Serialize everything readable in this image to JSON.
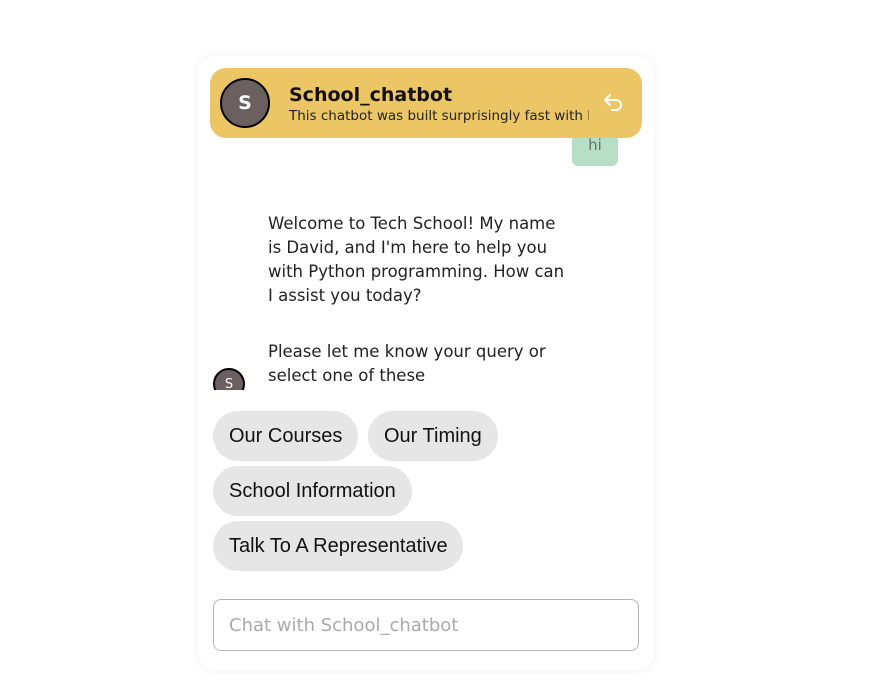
{
  "header": {
    "avatar_letter": "S",
    "title": "School_chatbot",
    "subtitle": "This chatbot was built surprisingly fast with Botpress",
    "restart_icon": "restart-icon"
  },
  "messages": {
    "user_message": "hi",
    "bot_message_1": "Welcome to Tech School! My name is David, and I'm here to help you with Python programming. How can I assist you today?",
    "bot_message_2": "Please let me know your query or select one of these",
    "bot_avatar_letter": "S"
  },
  "quick_replies": [
    {
      "label": "Our Courses"
    },
    {
      "label": "Our Timing"
    },
    {
      "label": "School Information"
    },
    {
      "label": "Talk To A Representative"
    }
  ],
  "composer": {
    "placeholder": "Chat with School_chatbot"
  },
  "colors": {
    "header_bg": "#ecc665",
    "user_bubble": "#b6dfc5",
    "avatar_bg": "#6b5f5f",
    "option_bg": "#e6e6e6"
  }
}
